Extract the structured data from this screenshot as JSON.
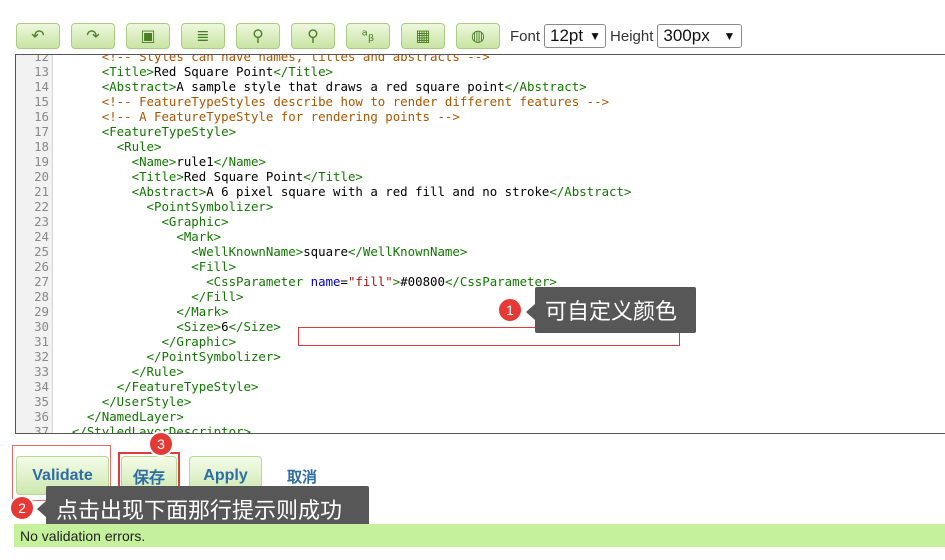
{
  "toolbar": {
    "buttons": [
      {
        "name": "undo-button",
        "icon": "undo-arrow-icon",
        "glyph": "↶"
      },
      {
        "name": "redo-button",
        "icon": "redo-arrow-icon",
        "glyph": "↷"
      },
      {
        "name": "insert-image-button",
        "icon": "image-insert-icon",
        "glyph": "▣"
      },
      {
        "name": "format-indent-button",
        "icon": "indent-lines-icon",
        "glyph": "≣"
      },
      {
        "name": "find-button",
        "icon": "binoculars-icon",
        "glyph": "⚲"
      },
      {
        "name": "replace-button",
        "icon": "binoculars-replace-icon",
        "glyph": "⚲"
      },
      {
        "name": "character-map-button",
        "icon": "character-ab-icon",
        "glyph": "ᵃᵦ"
      },
      {
        "name": "picture-button",
        "icon": "picture-frame-icon",
        "glyph": "▦"
      },
      {
        "name": "color-palette-button",
        "icon": "palette-icon",
        "glyph": "◍"
      }
    ],
    "font_label": "Font",
    "font_size": "12pt",
    "height_label": "Height",
    "height_value": "300px"
  },
  "editor": {
    "lines": [
      {
        "n": "12",
        "html": "      <span class='c'>&lt;!-- Styles can have names, titles and abstracts --&gt;</span>"
      },
      {
        "n": "13",
        "html": "      <span class='t'>&lt;Title&gt;</span>Red Square Point<span class='t'>&lt;/Title&gt;</span>"
      },
      {
        "n": "14",
        "html": "      <span class='t'>&lt;Abstract&gt;</span>A sample style that draws a red square point<span class='t'>&lt;/Abstract&gt;</span>"
      },
      {
        "n": "15",
        "html": "      <span class='c'>&lt;!-- FeatureTypeStyles describe how to render different features --&gt;</span>"
      },
      {
        "n": "16",
        "html": "      <span class='c'>&lt;!-- A FeatureTypeStyle for rendering points --&gt;</span>"
      },
      {
        "n": "17",
        "html": "      <span class='t'>&lt;FeatureTypeStyle&gt;</span>"
      },
      {
        "n": "18",
        "html": "        <span class='t'>&lt;Rule&gt;</span>"
      },
      {
        "n": "19",
        "html": "          <span class='t'>&lt;Name&gt;</span>rule1<span class='t'>&lt;/Name&gt;</span>"
      },
      {
        "n": "20",
        "html": "          <span class='t'>&lt;Title&gt;</span>Red Square Point<span class='t'>&lt;/Title&gt;</span>"
      },
      {
        "n": "21",
        "html": "          <span class='t'>&lt;Abstract&gt;</span>A 6 pixel square with a red fill and no stroke<span class='t'>&lt;/Abstract&gt;</span>"
      },
      {
        "n": "22",
        "html": "            <span class='t'>&lt;PointSymbolizer&gt;</span>"
      },
      {
        "n": "23",
        "html": "              <span class='t'>&lt;Graphic&gt;</span>"
      },
      {
        "n": "24",
        "html": "                <span class='t'>&lt;Mark&gt;</span>"
      },
      {
        "n": "25",
        "html": "                  <span class='t'>&lt;WellKnownName&gt;</span>square<span class='t'>&lt;/WellKnownName&gt;</span>"
      },
      {
        "n": "26",
        "html": "                  <span class='t'>&lt;Fill&gt;</span>"
      },
      {
        "n": "27",
        "html": "                    <span class='t'>&lt;CssParameter</span> <span class='a'>name</span>=<span class='s'>\"fill\"</span><span class='t'>&gt;</span>#00800<span class='t'>&lt;/CssParameter&gt;</span>"
      },
      {
        "n": "28",
        "html": "                  <span class='t'>&lt;/Fill&gt;</span>"
      },
      {
        "n": "29",
        "html": "                <span class='t'>&lt;/Mark&gt;</span>"
      },
      {
        "n": "30",
        "html": "                <span class='t'>&lt;Size&gt;</span>6<span class='t'>&lt;/Size&gt;</span>"
      },
      {
        "n": "31",
        "html": "              <span class='t'>&lt;/Graphic&gt;</span>"
      },
      {
        "n": "32",
        "html": "            <span class='t'>&lt;/PointSymbolizer&gt;</span>"
      },
      {
        "n": "33",
        "html": "          <span class='t'>&lt;/Rule&gt;</span>"
      },
      {
        "n": "34",
        "html": "        <span class='t'>&lt;/FeatureTypeStyle&gt;</span>"
      },
      {
        "n": "35",
        "html": "      <span class='t'>&lt;/UserStyle&gt;</span>"
      },
      {
        "n": "36",
        "html": "    <span class='t'>&lt;/NamedLayer&gt;</span>"
      },
      {
        "n": "37",
        "html": "  <span class='t'>&lt;/StyledLayerDescriptor&gt;</span>"
      }
    ]
  },
  "callouts": {
    "c1": {
      "num": "1",
      "text": "可自定义颜色"
    },
    "c2": {
      "num": "2",
      "text": "点击出现下面那行提示则成功"
    },
    "c3": {
      "num": "3"
    }
  },
  "actions": {
    "validate": "Validate",
    "save": "保存",
    "apply": "Apply",
    "cancel": "取消"
  },
  "status": {
    "message": "No validation errors."
  },
  "colors": {
    "button_green": "#c8e4a3",
    "status_green": "#c5f09c",
    "callout_red": "#e53935",
    "tooltip_gray": "#575757",
    "link_blue": "#2e6da4"
  }
}
